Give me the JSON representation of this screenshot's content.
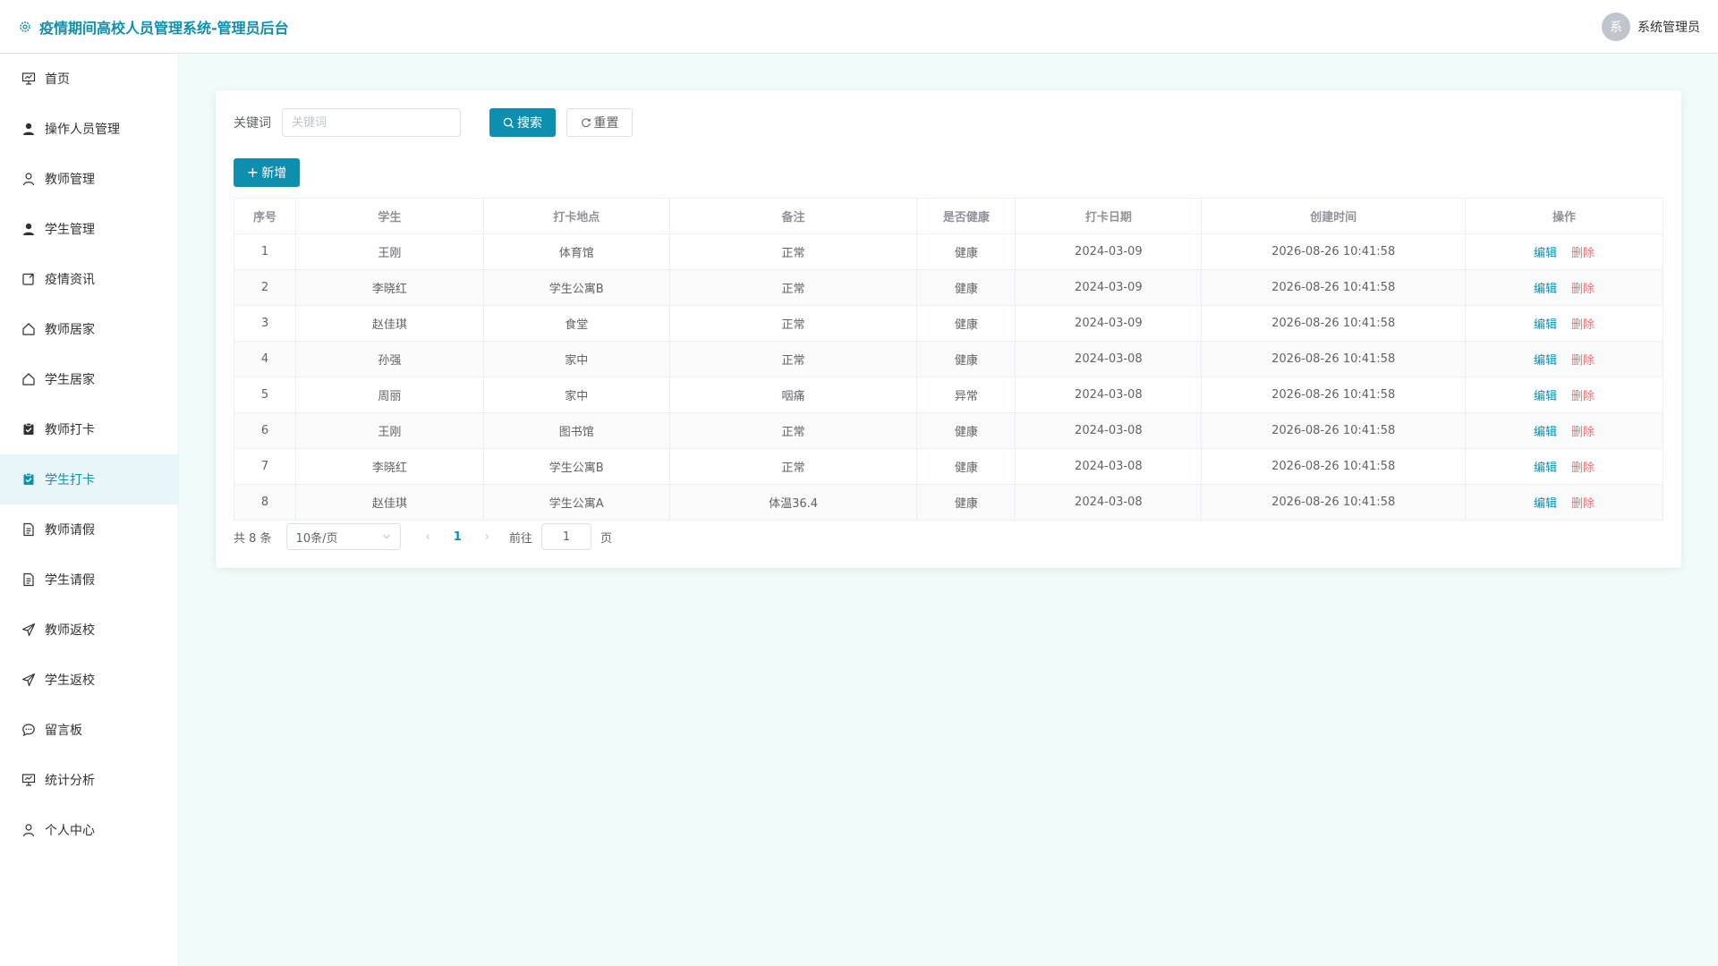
{
  "header": {
    "title": "疫情期间高校人员管理系统-管理员后台",
    "avatar_char": "系",
    "user_name": "系统管理员"
  },
  "sidebar": {
    "items": [
      {
        "label": "首页",
        "icon": "dashboard-icon"
      },
      {
        "label": "操作人员管理",
        "icon": "user-solid-icon"
      },
      {
        "label": "教师管理",
        "icon": "user-icon"
      },
      {
        "label": "学生管理",
        "icon": "user-solid-icon"
      },
      {
        "label": "疫情资讯",
        "icon": "news-icon"
      },
      {
        "label": "教师居家",
        "icon": "home-icon"
      },
      {
        "label": "学生居家",
        "icon": "home-icon"
      },
      {
        "label": "教师打卡",
        "icon": "checkin-icon"
      },
      {
        "label": "学生打卡",
        "icon": "checkin-icon",
        "active": true
      },
      {
        "label": "教师请假",
        "icon": "document-icon"
      },
      {
        "label": "学生请假",
        "icon": "document-icon"
      },
      {
        "label": "教师返校",
        "icon": "send-icon"
      },
      {
        "label": "学生返校",
        "icon": "send-icon"
      },
      {
        "label": "留言板",
        "icon": "chat-icon"
      },
      {
        "label": "统计分析",
        "icon": "chart-icon"
      },
      {
        "label": "个人中心",
        "icon": "user-icon"
      }
    ]
  },
  "search": {
    "label": "关键词",
    "placeholder": "关键词",
    "search_label": "搜索",
    "reset_label": "重置",
    "add_label": "新增"
  },
  "table": {
    "headers": [
      "序号",
      "学生",
      "打卡地点",
      "备注",
      "是否健康",
      "打卡日期",
      "创建时间",
      "操作"
    ],
    "rows": [
      {
        "no": "1",
        "student": "王刚",
        "location": "体育馆",
        "remark": "正常",
        "health": "健康",
        "date": "2024-03-09",
        "created": "2026-08-26 10:41:58"
      },
      {
        "no": "2",
        "student": "李晓红",
        "location": "学生公寓B",
        "remark": "正常",
        "health": "健康",
        "date": "2024-03-09",
        "created": "2026-08-26 10:41:58"
      },
      {
        "no": "3",
        "student": "赵佳琪",
        "location": "食堂",
        "remark": "正常",
        "health": "健康",
        "date": "2024-03-09",
        "created": "2026-08-26 10:41:58"
      },
      {
        "no": "4",
        "student": "孙强",
        "location": "家中",
        "remark": "正常",
        "health": "健康",
        "date": "2024-03-08",
        "created": "2026-08-26 10:41:58"
      },
      {
        "no": "5",
        "student": "周丽",
        "location": "家中",
        "remark": "咽痛",
        "health": "异常",
        "date": "2024-03-08",
        "created": "2026-08-26 10:41:58"
      },
      {
        "no": "6",
        "student": "王刚",
        "location": "图书馆",
        "remark": "正常",
        "health": "健康",
        "date": "2024-03-08",
        "created": "2026-08-26 10:41:58"
      },
      {
        "no": "7",
        "student": "李晓红",
        "location": "学生公寓B",
        "remark": "正常",
        "health": "健康",
        "date": "2024-03-08",
        "created": "2026-08-26 10:41:58"
      },
      {
        "no": "8",
        "student": "赵佳琪",
        "location": "学生公寓A",
        "remark": "体温36.4",
        "health": "健康",
        "date": "2024-03-08",
        "created": "2026-08-26 10:41:58"
      }
    ],
    "edit_label": "编辑",
    "delete_label": "删除"
  },
  "pagination": {
    "total_text": "共 8 条",
    "page_size": "10条/页",
    "current_page": "1",
    "goto_prefix": "前往",
    "goto_value": "1",
    "goto_suffix": "页"
  },
  "colors": {
    "accent": "#0e8fb0",
    "danger": "#f56c6c",
    "background": "#f0fcfa"
  }
}
